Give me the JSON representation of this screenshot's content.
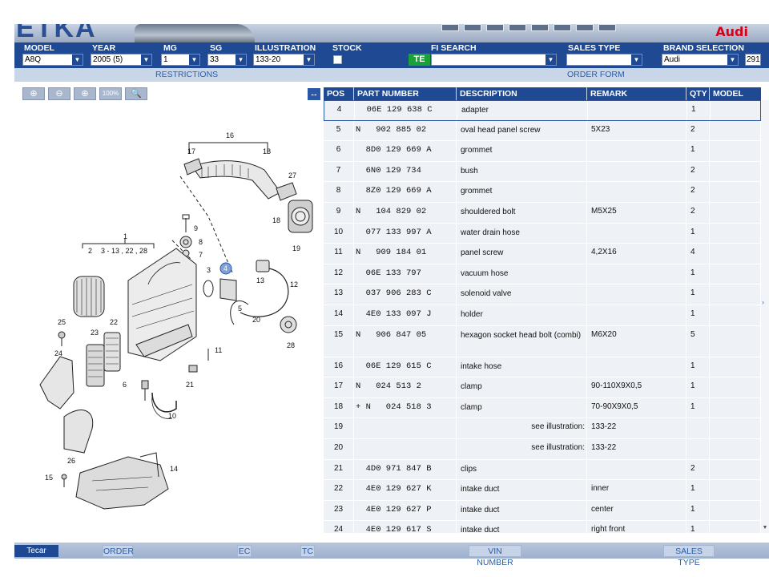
{
  "banner": {
    "logo_text": "ETKA",
    "brand_logo": "Audi"
  },
  "filters": {
    "model_label": "MODEL",
    "model_value": "A8Q",
    "year_label": "YEAR",
    "year_value": "2005 (5)",
    "mg_label": "MG",
    "mg_value": "1",
    "sg_label": "SG",
    "sg_value": "33",
    "illustration_label": "ILLUSTRATION",
    "illustration_value": "133-20",
    "stock_label": "STOCK",
    "fi_search_label": "FI SEARCH",
    "te_badge": "TE",
    "sales_type_label": "SALES TYPE",
    "brand_selection_label": "BRAND SELECTION",
    "brand_value": "Audi",
    "brand_count": "291"
  },
  "subbar": {
    "restrictions": "RESTRICTIONS",
    "order_form": "ORDER FORM"
  },
  "zoom": {
    "zoom_in": "⊕",
    "zoom_out": "⊖",
    "zoom_area": "⊕",
    "zoom_100": "100%",
    "search": "🔍",
    "expand": "↔"
  },
  "table": {
    "headers": {
      "pos": "POS",
      "part_number": "PART NUMBER",
      "description": "DESCRIPTION",
      "remark": "REMARK",
      "qty": "QTY",
      "model": "MODEL"
    },
    "see_illustration_label": "see illustration:",
    "rows": [
      {
        "pos": "4",
        "part": "  06E 129 638 C",
        "desc": "adapter",
        "remark": "",
        "qty": "1"
      },
      {
        "pos": "5",
        "part": "N   902 885 02",
        "desc": "oval head panel screw",
        "remark": "5X23",
        "qty": "2"
      },
      {
        "pos": "6",
        "part": "  8D0 129 669 A",
        "desc": "grommet",
        "remark": "",
        "qty": "1"
      },
      {
        "pos": "7",
        "part": "  6N0 129 734",
        "desc": "bush",
        "remark": "",
        "qty": "2"
      },
      {
        "pos": "8",
        "part": "  8Z0 129 669 A",
        "desc": "grommet",
        "remark": "",
        "qty": "2"
      },
      {
        "pos": "9",
        "part": "N   104 829 02",
        "desc": "shouldered bolt",
        "remark": "M5X25",
        "qty": "2"
      },
      {
        "pos": "10",
        "part": "  077 133 997 A",
        "desc": "water drain hose",
        "remark": "",
        "qty": "1"
      },
      {
        "pos": "11",
        "part": "N   909 184 01",
        "desc": "panel screw",
        "remark": "4,2X16",
        "qty": "4"
      },
      {
        "pos": "12",
        "part": "  06E 133 797",
        "desc": "vacuum hose",
        "remark": "",
        "qty": "1"
      },
      {
        "pos": "13",
        "part": "  037 906 283 C",
        "desc": "solenoid valve",
        "remark": "",
        "qty": "1"
      },
      {
        "pos": "14",
        "part": "  4E0 133 097 J",
        "desc": "holder",
        "remark": "",
        "qty": "1"
      },
      {
        "pos": "15",
        "part": "N   906 847 05",
        "desc": "hexagon socket head bolt (combi)",
        "remark": "M6X20",
        "qty": "5"
      },
      {
        "pos": "16",
        "part": "  06E 129 615 C",
        "desc": "intake hose",
        "remark": "",
        "qty": "1"
      },
      {
        "pos": "17",
        "part": "N   024 513 2",
        "desc": "clamp",
        "remark": "90-110X9X0,5",
        "qty": "1"
      },
      {
        "pos": "18",
        "part": "+ N   024 518 3",
        "desc": "clamp",
        "remark": "70-90X9X0,5",
        "qty": "1"
      },
      {
        "pos": "19",
        "part": "",
        "desc": "",
        "remark": "133-22",
        "qty": "",
        "see": true
      },
      {
        "pos": "20",
        "part": "",
        "desc": "",
        "remark": "133-22",
        "qty": "",
        "see": true
      },
      {
        "pos": "21",
        "part": "  4D0 971 847 B",
        "desc": "clips",
        "remark": "",
        "qty": "2"
      },
      {
        "pos": "22",
        "part": "  4E0 129 627 K",
        "desc": "intake duct",
        "remark": "inner",
        "qty": "1"
      },
      {
        "pos": "23",
        "part": "  4E0 129 627 P",
        "desc": "intake duct",
        "remark": "center",
        "qty": "1"
      },
      {
        "pos": "24",
        "part": "  4E0 129 617 S",
        "desc": "intake duct",
        "remark": "right front",
        "qty": "1"
      }
    ]
  },
  "illustration": {
    "callouts": [
      "1",
      "2",
      "3 - 13 , 22 , 28",
      "3",
      "4",
      "5",
      "6",
      "7",
      "8",
      "9",
      "10",
      "11",
      "12",
      "13",
      "14",
      "15",
      "16",
      "17",
      "18",
      "18",
      "19",
      "20",
      "21",
      "22",
      "23",
      "24",
      "25",
      "26",
      "27",
      "28"
    ]
  },
  "footer": {
    "forum": "Tecar Forum",
    "order": "ORDER",
    "ec": "EC",
    "tc": "TC",
    "vin_number": "VIN NUMBER",
    "sales_type": "SALES TYPE"
  },
  "colors": {
    "header_blue": "#1f4a93",
    "subbar": "#c9d6e8",
    "table_bg": "#eef1f6",
    "brand_red": "#d9001b",
    "te_green": "#1aa23a"
  }
}
